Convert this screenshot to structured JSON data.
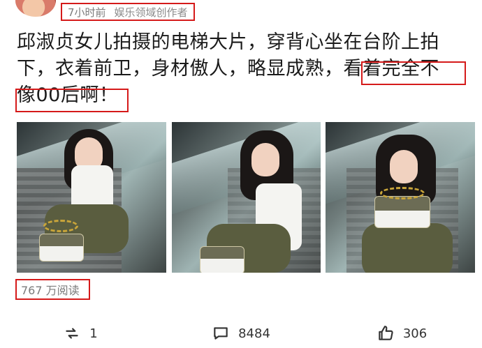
{
  "meta": {
    "time": "7小时前",
    "creator": "娱乐领域创作者"
  },
  "post": {
    "line1": "邱淑贞女儿拍摄的电梯大片，穿背心坐在台阶上拍",
    "line2": "下，衣着前卫，身材傲人，略显成熟，看着完全不",
    "line3": "像00后啊！"
  },
  "photos": [
    {
      "name": "photo-1"
    },
    {
      "name": "photo-2"
    },
    {
      "name": "photo-3"
    }
  ],
  "stats": {
    "reads": "767 万阅读"
  },
  "actions": [
    {
      "icon": "repost-icon",
      "count": "1"
    },
    {
      "icon": "comment-icon",
      "count": "8484"
    },
    {
      "icon": "like-icon",
      "count": "306"
    }
  ],
  "colors": {
    "highlight_border": "#d51a1a",
    "meta_text": "#8b8b8b"
  }
}
